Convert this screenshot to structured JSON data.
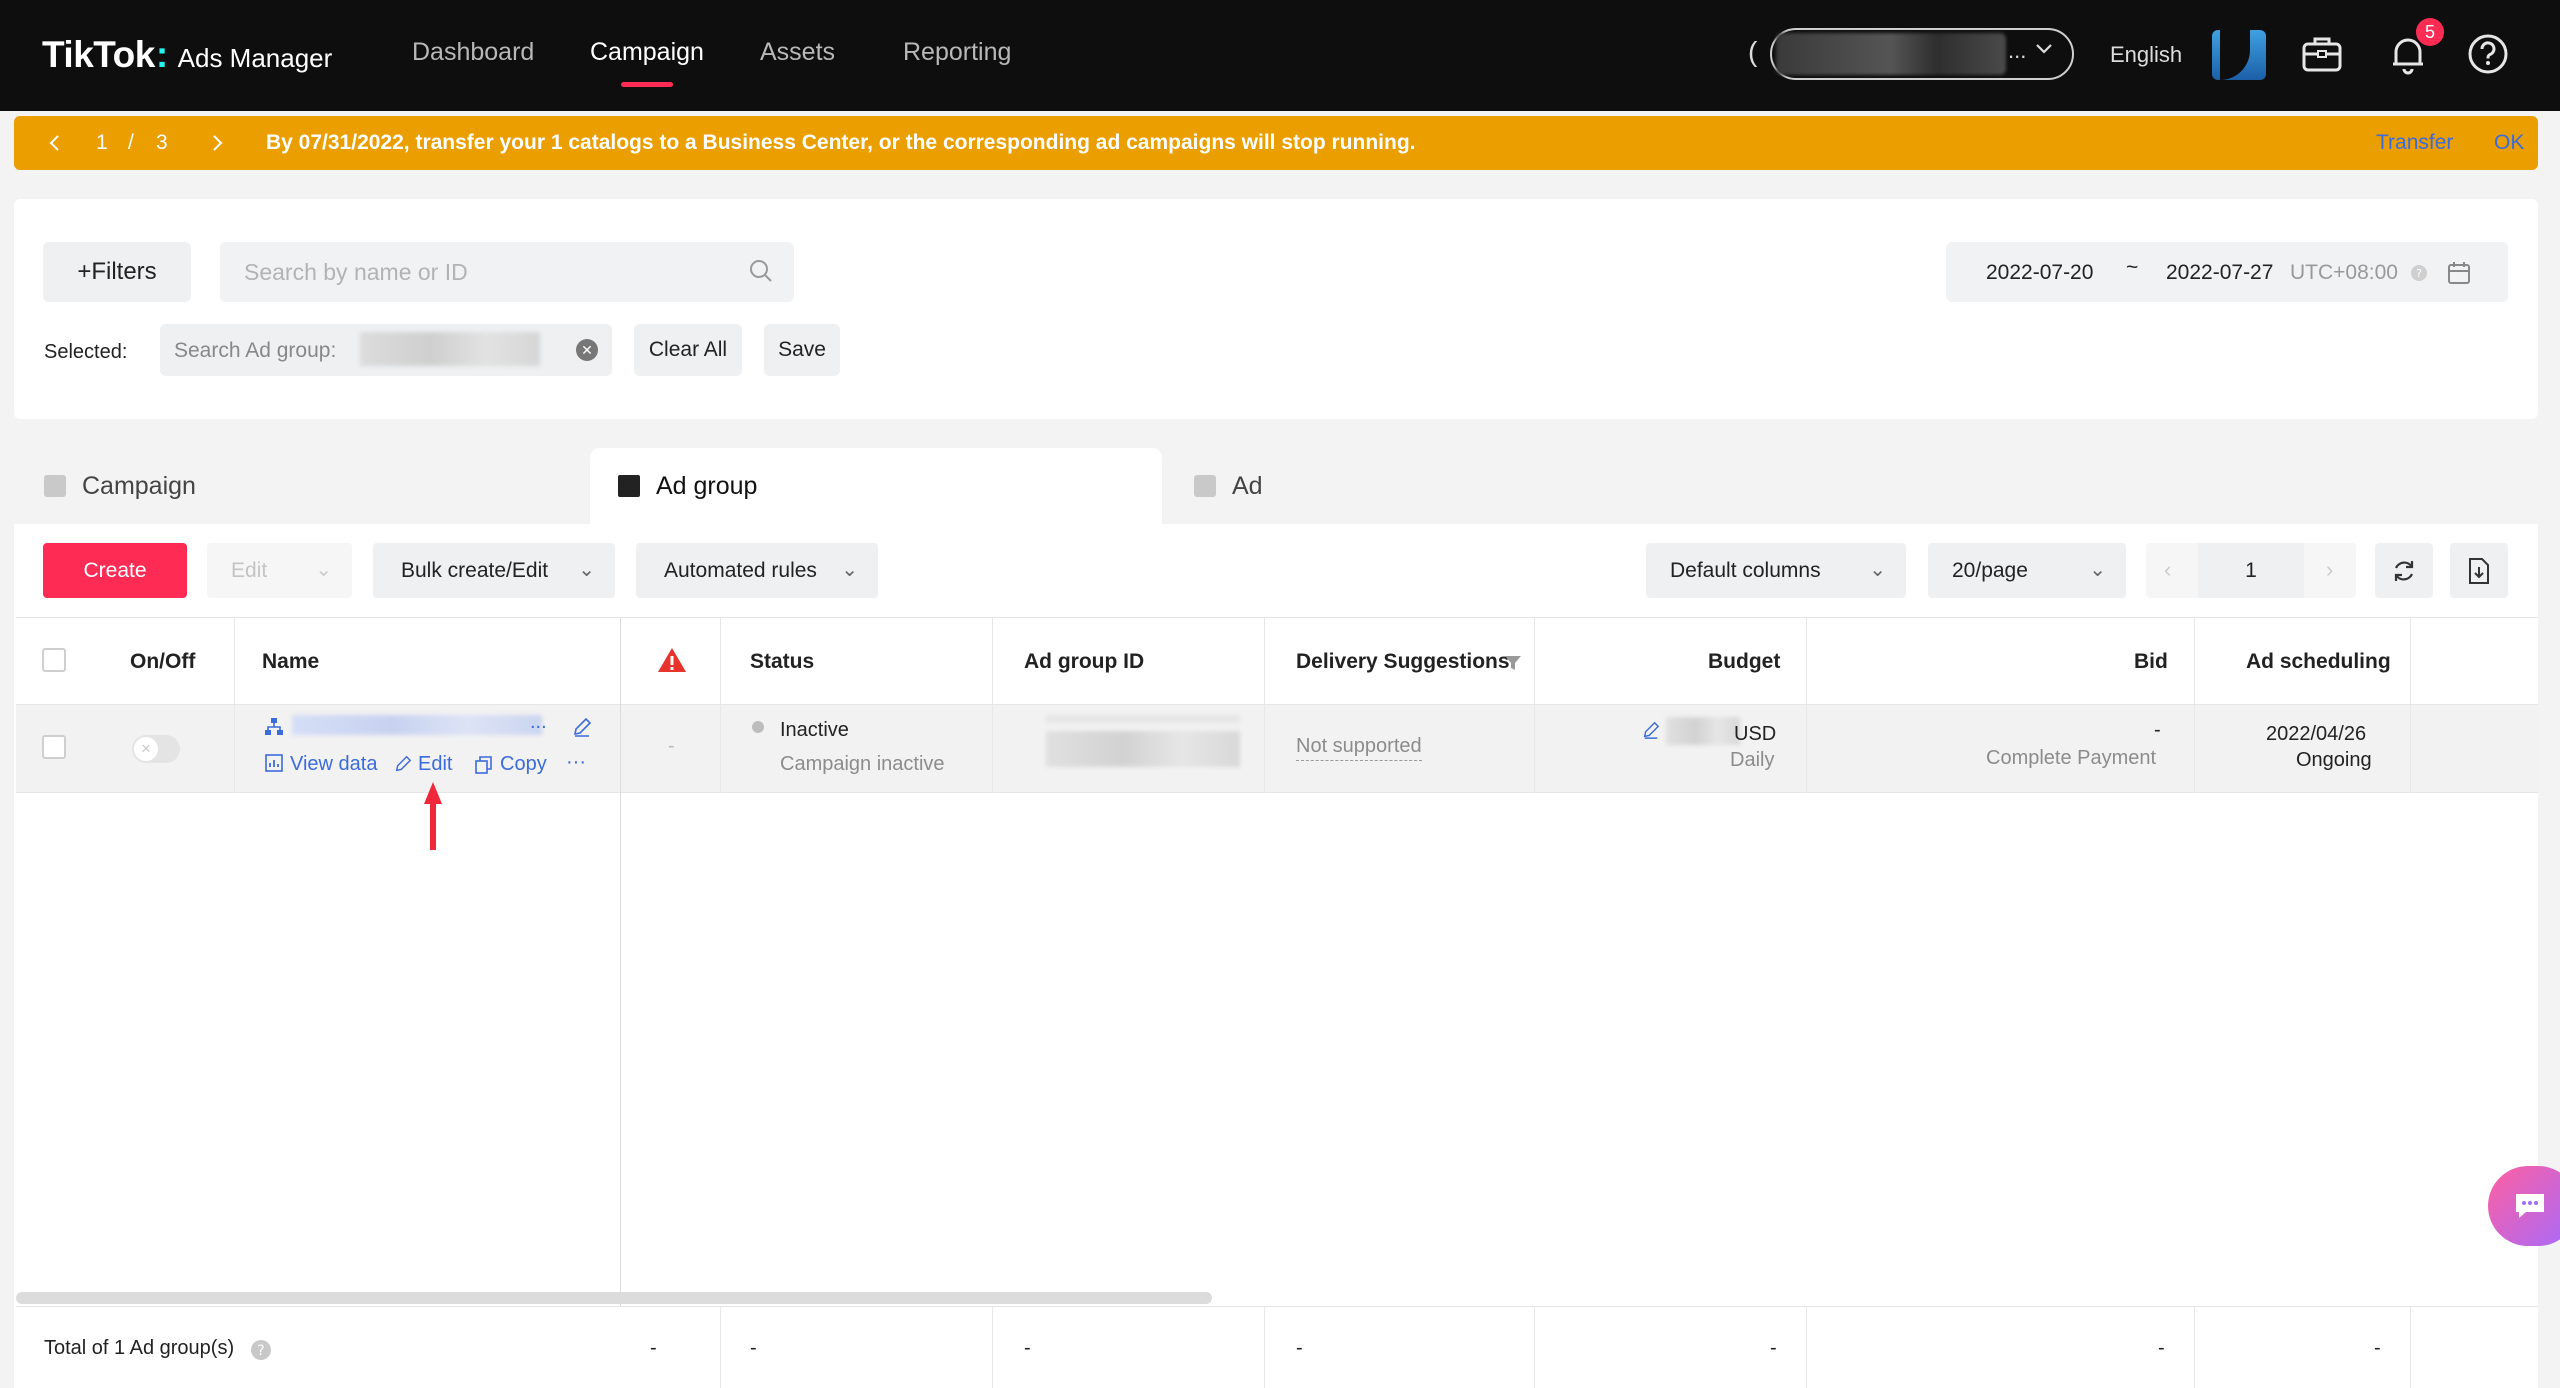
{
  "topnav": {
    "brand": "TikTok",
    "brand_dot": ":",
    "product": "Ads Manager",
    "items": [
      "Dashboard",
      "Campaign",
      "Assets",
      "Reporting"
    ],
    "active_item": "Campaign",
    "account_paren": "(",
    "account_ellipsis": "...",
    "language": "English",
    "notification_count": "5"
  },
  "banner": {
    "page_current": "1",
    "page_sep": "/",
    "page_total": "3",
    "message": "By 07/31/2022, transfer your 1 catalogs to a Business Center, or the corresponding ad campaigns will stop running.",
    "transfer_label": "Transfer",
    "ok_label": "OK"
  },
  "filters": {
    "filters_label": "+Filters",
    "search_placeholder": "Search by name or ID",
    "selected_label": "Selected:",
    "selected_chip": "Search Ad group:",
    "clear_all_label": "Clear All",
    "save_label": "Save",
    "date_start": "2022-07-20",
    "date_sep": "~",
    "date_end": "2022-07-27",
    "timezone": "UTC+08:00"
  },
  "tabs": [
    {
      "label": "Campaign",
      "active": false
    },
    {
      "label": "Ad group",
      "active": true
    },
    {
      "label": "Ad",
      "active": false
    }
  ],
  "toolbar": {
    "create_label": "Create",
    "edit_label": "Edit",
    "bulk_label": "Bulk create/Edit",
    "automated_label": "Automated rules",
    "columns_label": "Default columns",
    "per_page_label": "20/page",
    "page_number": "1"
  },
  "table": {
    "headers": {
      "onoff": "On/Off",
      "name": "Name",
      "status": "Status",
      "adgroup_id": "Ad group ID",
      "delivery": "Delivery Suggestions",
      "budget": "Budget",
      "bid": "Bid",
      "scheduling": "Ad scheduling"
    },
    "row": {
      "name_ellipsis": "...",
      "view_data_label": "View data",
      "edit_label": "Edit",
      "copy_label": "Copy",
      "more_label": "···",
      "warning_cell": "-",
      "status": "Inactive",
      "status_sub": "Campaign inactive",
      "delivery": "Not supported",
      "budget_currency": "USD",
      "budget_type": "Daily",
      "bid_value": "-",
      "bid_sub": "Complete Payment",
      "schedule_date": "2022/04/26",
      "schedule_state": "Ongoing"
    },
    "footer": {
      "total_label": "Total of 1 Ad group(s)",
      "dash": "-"
    }
  },
  "colors": {
    "accent": "#fe2c55",
    "banner": "#eb9e00",
    "link": "#3c6bdc",
    "warning": "#e8322c"
  }
}
